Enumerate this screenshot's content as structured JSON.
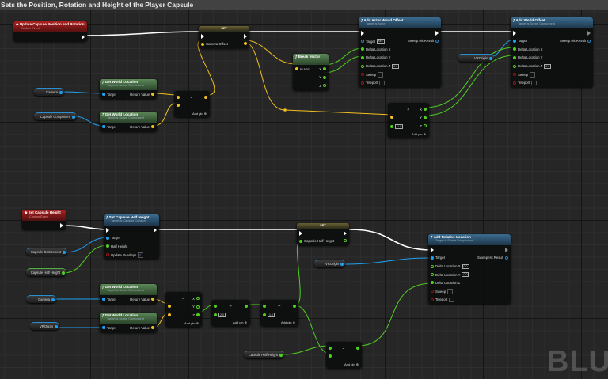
{
  "comment_title": "Sets the Position, Rotation and Height of the Player Capsule",
  "watermark": "BLU",
  "colors": {
    "exec": "#ffffff",
    "object": "#1fa0f0",
    "vector": "#f0c020",
    "float": "#50d020",
    "bool": "#a01010",
    "struct": "#2a7fc0"
  },
  "nodes": [
    {
      "id": "ev1",
      "kind": "event",
      "title": "Update Capsule Position and Rotation",
      "subtitle": "Custom Event",
      "rows": [
        {
          "r": {
            "type": "exec",
            "filled": true
          }
        }
      ]
    },
    {
      "id": "set1",
      "kind": "set",
      "title": "SET",
      "rows": [
        {
          "l": {
            "type": "exec",
            "filled": true
          },
          "r": {
            "type": "exec",
            "filled": true
          }
        },
        {
          "l": {
            "type": "vector",
            "filled": true,
            "label": "Camera Offset"
          },
          "r": {
            "type": "vector",
            "filled": true
          }
        }
      ]
    },
    {
      "id": "aawo",
      "kind": "func",
      "title": "Add Actor World Offset",
      "subtitle": "Target is Actor",
      "rows": [
        {
          "l": {
            "type": "exec",
            "filled": true
          },
          "r": {
            "type": "exec",
            "filled": true
          }
        },
        {
          "l": {
            "type": "struct",
            "filled": false,
            "label": "Target",
            "value": "self"
          },
          "r": {
            "type": "struct",
            "filled": false,
            "label": "Sweep Hit Result"
          }
        },
        {
          "l": {
            "type": "float",
            "filled": true,
            "label": "Delta Location X"
          }
        },
        {
          "l": {
            "type": "float",
            "filled": true,
            "label": "Delta Location Y"
          }
        },
        {
          "l": {
            "type": "float",
            "filled": false,
            "label": "Delta Location Z",
            "value": "0.0"
          }
        },
        {
          "l": {
            "type": "bool",
            "filled": false,
            "label": "Sweep",
            "check": false
          }
        },
        {
          "l": {
            "type": "bool",
            "filled": false,
            "label": "Teleport",
            "check": false
          }
        }
      ]
    },
    {
      "id": "awo",
      "kind": "func",
      "title": "Add World Offset",
      "subtitle": "Target is Scene Component",
      "rows": [
        {
          "l": {
            "type": "exec",
            "filled": true
          },
          "r": {
            "type": "exec",
            "filled": false
          }
        },
        {
          "l": {
            "type": "object",
            "filled": true,
            "label": "Target"
          },
          "r": {
            "type": "struct",
            "filled": false,
            "label": "Sweep Hit Result"
          }
        },
        {
          "l": {
            "type": "float",
            "filled": true,
            "label": "Delta Location X"
          }
        },
        {
          "l": {
            "type": "float",
            "filled": true,
            "label": "Delta Location Y"
          }
        },
        {
          "l": {
            "type": "float",
            "filled": false,
            "label": "Delta Location Z",
            "value": "0.0"
          }
        },
        {
          "l": {
            "type": "bool",
            "filled": false,
            "label": "Sweep",
            "check": false
          }
        },
        {
          "l": {
            "type": "bool",
            "filled": false,
            "label": "Teleport",
            "check": false
          }
        }
      ]
    },
    {
      "id": "brk",
      "kind": "pure",
      "title": "Break Vector",
      "rows": [
        {
          "l": {
            "type": "vector",
            "filled": true,
            "label": "In Vec"
          },
          "r": {
            "type": "float",
            "filled": true,
            "label": "X"
          }
        },
        {
          "r": {
            "type": "float",
            "filled": true,
            "label": "Y"
          }
        },
        {
          "r": {
            "type": "float",
            "filled": false,
            "label": "Z"
          }
        }
      ]
    },
    {
      "id": "gwl1",
      "kind": "pure",
      "title": "Get World Location",
      "subtitle": "Target is Scene Component",
      "rows": [
        {
          "l": {
            "type": "object",
            "filled": true,
            "label": "Target"
          },
          "r": {
            "type": "vector",
            "filled": true,
            "label": "Return Value"
          }
        }
      ]
    },
    {
      "id": "gwl2",
      "kind": "pure",
      "title": "Get World Location",
      "subtitle": "Target is Scene Component",
      "rows": [
        {
          "l": {
            "type": "object",
            "filled": true,
            "label": "Target"
          },
          "r": {
            "type": "vector",
            "filled": true,
            "label": "Return Value"
          }
        }
      ]
    },
    {
      "id": "sub1",
      "kind": "math",
      "symbol": "-",
      "addpin": "Add pin",
      "rows": [
        {
          "l": {
            "type": "vector",
            "filled": true
          },
          "r": {
            "type": "vector",
            "filled": true
          }
        },
        {
          "l": {
            "type": "vector",
            "filled": true
          }
        }
      ]
    },
    {
      "id": "mul1",
      "kind": "math",
      "symbol": "×",
      "addpin": "Add pin",
      "rows": [
        {
          "r": {
            "type": "float",
            "filled": true,
            "label": "X"
          }
        },
        {
          "l": {
            "type": "vector",
            "filled": true
          },
          "r": {
            "type": "float",
            "filled": true,
            "label": "Y"
          }
        },
        {
          "l": {
            "type": "float",
            "filled": true,
            "value": "-1.0"
          },
          "r": {
            "type": "float",
            "filled": false,
            "label": "Z"
          }
        }
      ]
    },
    {
      "id": "ev2",
      "kind": "event",
      "title": "Set Capsule Height",
      "subtitle": "Custom Event",
      "rows": [
        {
          "r": {
            "type": "exec",
            "filled": true
          }
        }
      ]
    },
    {
      "id": "schh",
      "kind": "func",
      "title": "Set Capsule Half Height",
      "subtitle": "Target is Capsule Collision",
      "rows": [
        {
          "l": {
            "type": "exec",
            "filled": true
          },
          "r": {
            "type": "exec",
            "filled": true
          }
        },
        {
          "l": {
            "type": "object",
            "filled": true,
            "label": "Target"
          }
        },
        {
          "l": {
            "type": "float",
            "filled": true,
            "label": "Half Height"
          }
        },
        {
          "l": {
            "type": "bool",
            "filled": false,
            "label": "Update Overlaps",
            "check": true
          }
        }
      ]
    },
    {
      "id": "gwl3",
      "kind": "pure",
      "title": "Get World Location",
      "subtitle": "Target is Scene Component",
      "rows": [
        {
          "l": {
            "type": "object",
            "filled": true,
            "label": "Target"
          },
          "r": {
            "type": "vector",
            "filled": true,
            "label": "Return Value"
          }
        }
      ]
    },
    {
      "id": "gwl4",
      "kind": "pure",
      "title": "Get World Location",
      "subtitle": "Target is Scene Component",
      "rows": [
        {
          "l": {
            "type": "object",
            "filled": true,
            "label": "Target"
          },
          "r": {
            "type": "vector",
            "filled": true,
            "label": "Return Value"
          }
        }
      ]
    },
    {
      "id": "sub2",
      "kind": "math",
      "symbol": "-",
      "addpin": "Add pin",
      "rows": [
        {
          "r": {
            "type": "float",
            "filled": false,
            "label": "X"
          }
        },
        {
          "l": {
            "type": "vector",
            "filled": true
          },
          "r": {
            "type": "float",
            "filled": false,
            "label": "Y"
          }
        },
        {
          "l": {
            "type": "vector",
            "filled": true
          },
          "r": {
            "type": "float",
            "filled": true,
            "label": "Z"
          }
        }
      ]
    },
    {
      "id": "div1",
      "kind": "math",
      "symbol": "÷",
      "addpin": "Add pin",
      "rows": [
        {
          "l": {
            "type": "float",
            "filled": true
          },
          "r": {
            "type": "float",
            "filled": true
          }
        },
        {
          "l": {
            "type": "float",
            "filled": true,
            "value": "2.0"
          }
        }
      ]
    },
    {
      "id": "add1",
      "kind": "math",
      "symbol": "+",
      "addpin": "Add pin",
      "rows": [
        {
          "l": {
            "type": "float",
            "filled": true
          },
          "r": {
            "type": "float",
            "filled": true
          }
        },
        {
          "l": {
            "type": "float",
            "filled": true,
            "value": "1.0"
          }
        }
      ]
    },
    {
      "id": "set2",
      "kind": "set",
      "title": "SET",
      "rows": [
        {
          "l": {
            "type": "exec",
            "filled": true
          },
          "r": {
            "type": "exec",
            "filled": true
          }
        },
        {
          "l": {
            "type": "float",
            "filled": true,
            "label": "Capsule Half Height"
          },
          "r": {
            "type": "float",
            "filled": false
          }
        }
      ]
    },
    {
      "id": "arl",
      "kind": "func",
      "title": "Add Relative Location",
      "subtitle": "Target is Scene Component",
      "rows": [
        {
          "l": {
            "type": "exec",
            "filled": true
          },
          "r": {
            "type": "exec",
            "filled": false
          }
        },
        {
          "l": {
            "type": "object",
            "filled": true,
            "label": "Target"
          },
          "r": {
            "type": "struct",
            "filled": false,
            "label": "Sweep Hit Result"
          }
        },
        {
          "l": {
            "type": "float",
            "filled": false,
            "label": "Delta Location X",
            "value": "0.0"
          }
        },
        {
          "l": {
            "type": "float",
            "filled": false,
            "label": "Delta Location Y",
            "value": "0.0"
          }
        },
        {
          "l": {
            "type": "float",
            "filled": true,
            "label": "Delta Location Z"
          }
        },
        {
          "l": {
            "type": "bool",
            "filled": false,
            "label": "Sweep",
            "check": false
          }
        },
        {
          "l": {
            "type": "bool",
            "filled": false,
            "label": "Teleport",
            "check": false
          }
        }
      ]
    },
    {
      "id": "sub3",
      "kind": "math",
      "symbol": "-",
      "addpin": "Add pin",
      "rows": [
        {
          "l": {
            "type": "float",
            "filled": true
          },
          "r": {
            "type": "float",
            "filled": true
          }
        },
        {
          "l": {
            "type": "float",
            "filled": true
          }
        }
      ]
    }
  ],
  "variables": [
    {
      "id": "v_cam1",
      "label": "Camera",
      "type": "object"
    },
    {
      "id": "v_cap1",
      "label": "Capsule Component",
      "type": "object"
    },
    {
      "id": "v_vro1",
      "label": "VROrigin",
      "type": "object"
    },
    {
      "id": "v_cap2",
      "label": "Capsule Component",
      "type": "object"
    },
    {
      "id": "v_chh1",
      "label": "Capsule Half Height",
      "type": "float"
    },
    {
      "id": "v_cam2",
      "label": "Camera",
      "type": "object"
    },
    {
      "id": "v_vro2",
      "label": "VROrigin",
      "type": "object"
    },
    {
      "id": "v_vro3",
      "label": "VROrigin",
      "type": "object"
    },
    {
      "id": "v_chh2",
      "label": "Capsule Half Height",
      "type": "float"
    }
  ]
}
